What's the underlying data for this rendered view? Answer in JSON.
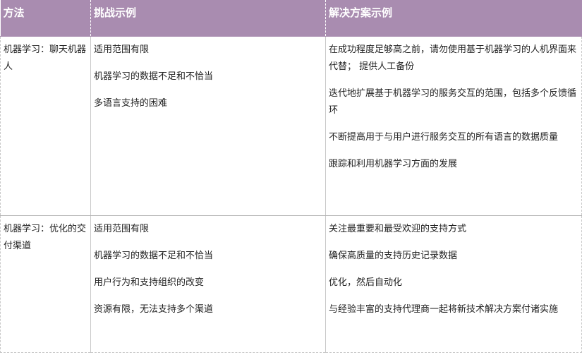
{
  "table": {
    "headers": [
      "方法",
      "挑战示例",
      "解决方案示例"
    ],
    "rows": [
      {
        "method": "机器学习：聊天机器人",
        "challenges": [
          "适用范围有限",
          "机器学习的数据不足和不恰当",
          "多语言支持的困难"
        ],
        "solutions": [
          "在成功程度足够高之前，请勿使用基于机器学习的人机界面来代替； 提供人工备份",
          "迭代地扩展基于机器学习的服务交互的范围，包括多个反馈循环",
          "不断提高用于与用户进行服务交互的所有语言的数据质量",
          "跟踪和利用机器学习方面的发展"
        ]
      },
      {
        "method": "机器学习：优化的交付渠道",
        "challenges": [
          "适用范围有限",
          "机器学习的数据不足和不恰当",
          "用户行为和支持组织的改变",
          "资源有限，无法支持多个渠道"
        ],
        "solutions": [
          "关注最重要和最受欢迎的支持方式",
          "确保高质量的支持历史记录数据",
          "优化，然后自动化",
          "与经验丰富的支持代理商一起将新技术解决方案付诸实施"
        ]
      }
    ]
  }
}
